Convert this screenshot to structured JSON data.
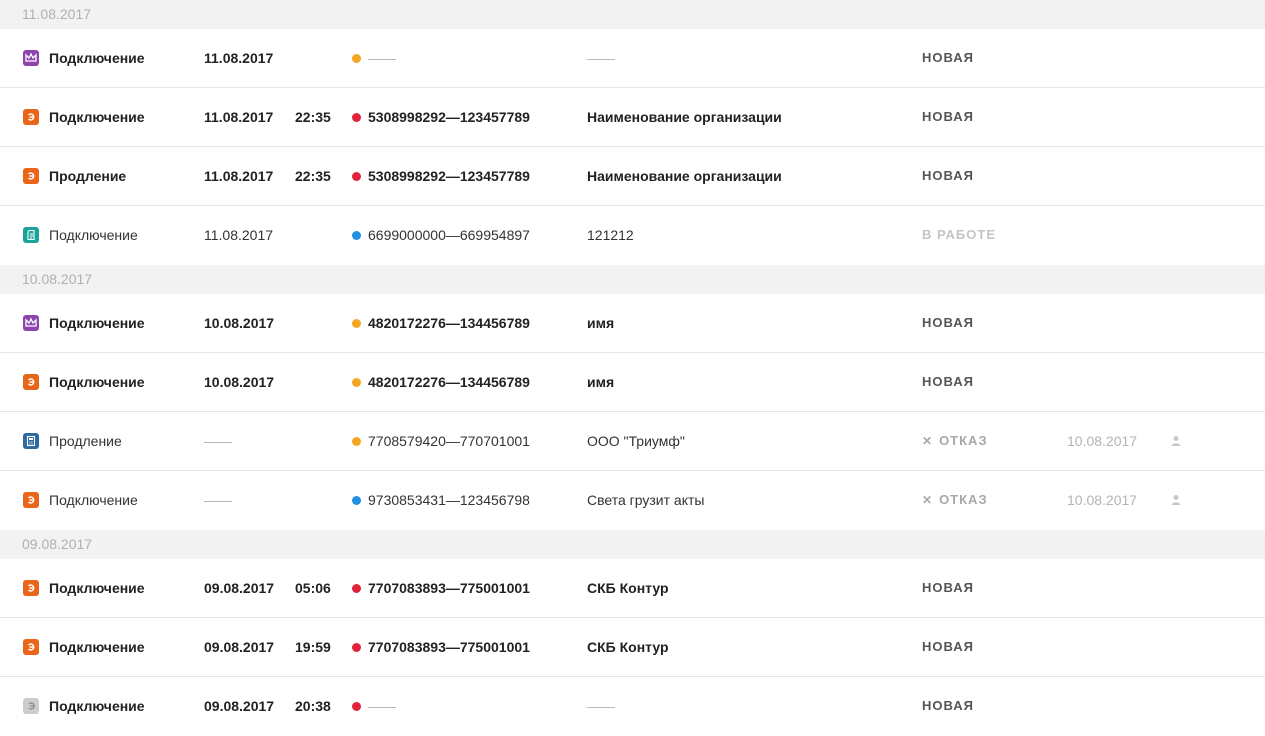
{
  "colors": {
    "orange": "#f5a623",
    "red": "#e0233a",
    "blue": "#1e8fe1",
    "purple_icon": "#8e44ad",
    "orange_icon": "#e8651a",
    "teal_icon": "#1aa39a",
    "blue_icon": "#2c6aa0",
    "gray_icon": "#cccccc"
  },
  "groups": [
    {
      "date": "11.08.2017",
      "rows": [
        {
          "bold": true,
          "icon": "crown-icon",
          "type": "Подключение",
          "date": "11.08.2017",
          "time": "",
          "dot": "orange",
          "number": "",
          "org": "",
          "status": "НОВАЯ",
          "status_kind": "new",
          "status_date": ""
        },
        {
          "bold": true,
          "icon": "e-icon",
          "type": "Подключение",
          "date": "11.08.2017",
          "time": "22:35",
          "dot": "red",
          "number": "5308998292—123457789",
          "org": "Наименование организации",
          "status": "НОВАЯ",
          "status_kind": "new",
          "status_date": ""
        },
        {
          "bold": true,
          "icon": "e-icon",
          "type": "Продление",
          "date": "11.08.2017",
          "time": "22:35",
          "dot": "red",
          "number": "5308998292—123457789",
          "org": "Наименование организации",
          "status": "НОВАЯ",
          "status_kind": "new",
          "status_date": ""
        },
        {
          "bold": false,
          "icon": "document-icon",
          "type": "Подключение",
          "date": "11.08.2017",
          "time": "",
          "dot": "blue",
          "number": "6699000000—669954897",
          "org": "121212",
          "status": "В РАБОТЕ",
          "status_kind": "work",
          "status_date": ""
        }
      ]
    },
    {
      "date": "10.08.2017",
      "rows": [
        {
          "bold": true,
          "icon": "crown-icon",
          "type": "Подключение",
          "date": "10.08.2017",
          "time": "",
          "dot": "orange",
          "number": "4820172276—134456789",
          "org": "имя",
          "status": "НОВАЯ",
          "status_kind": "new",
          "status_date": ""
        },
        {
          "bold": true,
          "icon": "e-icon",
          "type": "Подключение",
          "date": "10.08.2017",
          "time": "",
          "dot": "orange",
          "number": "4820172276—134456789",
          "org": "имя",
          "status": "НОВАЯ",
          "status_kind": "new",
          "status_date": ""
        },
        {
          "bold": false,
          "icon": "calculator-icon",
          "type": "Продление",
          "date": "",
          "time": "",
          "dot": "orange",
          "number": "7708579420—770701001",
          "org": "ООО \"Триумф\"",
          "status": "ОТКАЗ",
          "status_kind": "reject",
          "status_date": "10.08.2017"
        },
        {
          "bold": false,
          "icon": "e-icon",
          "type": "Подключение",
          "date": "",
          "time": "",
          "dot": "blue",
          "number": "9730853431—123456798",
          "org": "Света грузит акты",
          "status": "ОТКАЗ",
          "status_kind": "reject",
          "status_date": "10.08.2017"
        }
      ]
    },
    {
      "date": "09.08.2017",
      "rows": [
        {
          "bold": true,
          "icon": "e-icon",
          "type": "Подключение",
          "date": "09.08.2017",
          "time": "05:06",
          "dot": "red",
          "number": "7707083893—775001001",
          "org": "СКБ Контур",
          "status": "НОВАЯ",
          "status_kind": "new",
          "status_date": ""
        },
        {
          "bold": true,
          "icon": "e-icon",
          "type": "Подключение",
          "date": "09.08.2017",
          "time": "19:59",
          "dot": "red",
          "number": "7707083893—775001001",
          "org": "СКБ Контур",
          "status": "НОВАЯ",
          "status_kind": "new",
          "status_date": ""
        },
        {
          "bold": true,
          "icon": "e-gray-icon",
          "type": "Подключение",
          "date": "09.08.2017",
          "time": "20:38",
          "dot": "red",
          "number": "",
          "org": "",
          "status": "НОВАЯ",
          "status_kind": "new",
          "status_date": ""
        }
      ]
    }
  ]
}
